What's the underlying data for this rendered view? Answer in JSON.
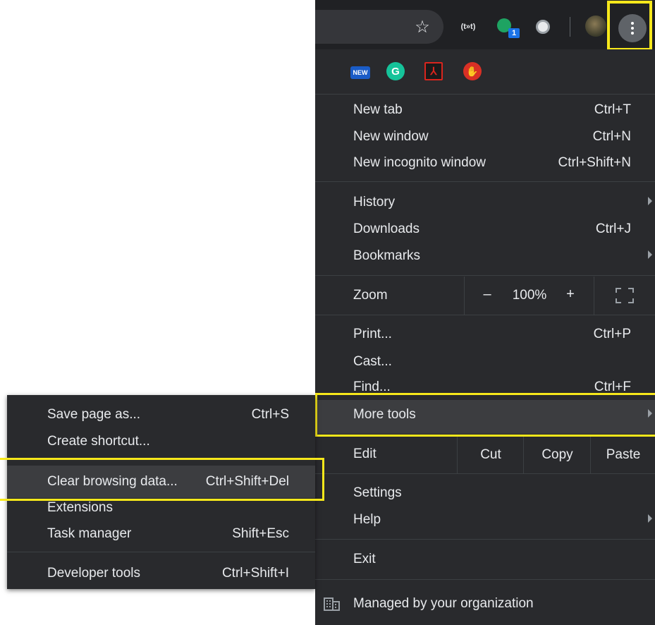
{
  "toolbar": {
    "icons": [
      "star-icon",
      "broadcast-icon",
      "extension-badge-icon",
      "circle-extension-icon",
      "avatar",
      "kebab-menu-icon"
    ],
    "badge_count": "1",
    "broadcast_text": "(t»t)",
    "highlight_color": "#f7e81b"
  },
  "extensions": {
    "new_label": "NEW",
    "grammarly_letter": "G",
    "acrobat_glyph": "⅄",
    "adblock_glyph": "✋"
  },
  "menu": {
    "new_tab": {
      "label": "New tab",
      "shortcut": "Ctrl+T"
    },
    "new_window": {
      "label": "New window",
      "shortcut": "Ctrl+N"
    },
    "new_incognito": {
      "label": "New incognito window",
      "shortcut": "Ctrl+Shift+N"
    },
    "history": {
      "label": "History"
    },
    "downloads": {
      "label": "Downloads",
      "shortcut": "Ctrl+J"
    },
    "bookmarks": {
      "label": "Bookmarks"
    },
    "zoom": {
      "label": "Zoom",
      "minus": "–",
      "value": "100%",
      "plus": "+"
    },
    "print": {
      "label": "Print...",
      "shortcut": "Ctrl+P"
    },
    "cast": {
      "label": "Cast..."
    },
    "find": {
      "label": "Find...",
      "shortcut": "Ctrl+F"
    },
    "more_tools": {
      "label": "More tools"
    },
    "edit": {
      "label": "Edit",
      "cut": "Cut",
      "copy": "Copy",
      "paste": "Paste"
    },
    "settings": {
      "label": "Settings"
    },
    "help": {
      "label": "Help"
    },
    "exit": {
      "label": "Exit"
    },
    "managed": {
      "label": "Managed by your organization"
    }
  },
  "submenu": {
    "save_page": {
      "label": "Save page as...",
      "shortcut": "Ctrl+S"
    },
    "create_shortcut": {
      "label": "Create shortcut..."
    },
    "clear_browsing": {
      "label": "Clear browsing data...",
      "shortcut": "Ctrl+Shift+Del"
    },
    "extensions": {
      "label": "Extensions"
    },
    "task_manager": {
      "label": "Task manager",
      "shortcut": "Shift+Esc"
    },
    "developer_tools": {
      "label": "Developer tools",
      "shortcut": "Ctrl+Shift+I"
    }
  }
}
